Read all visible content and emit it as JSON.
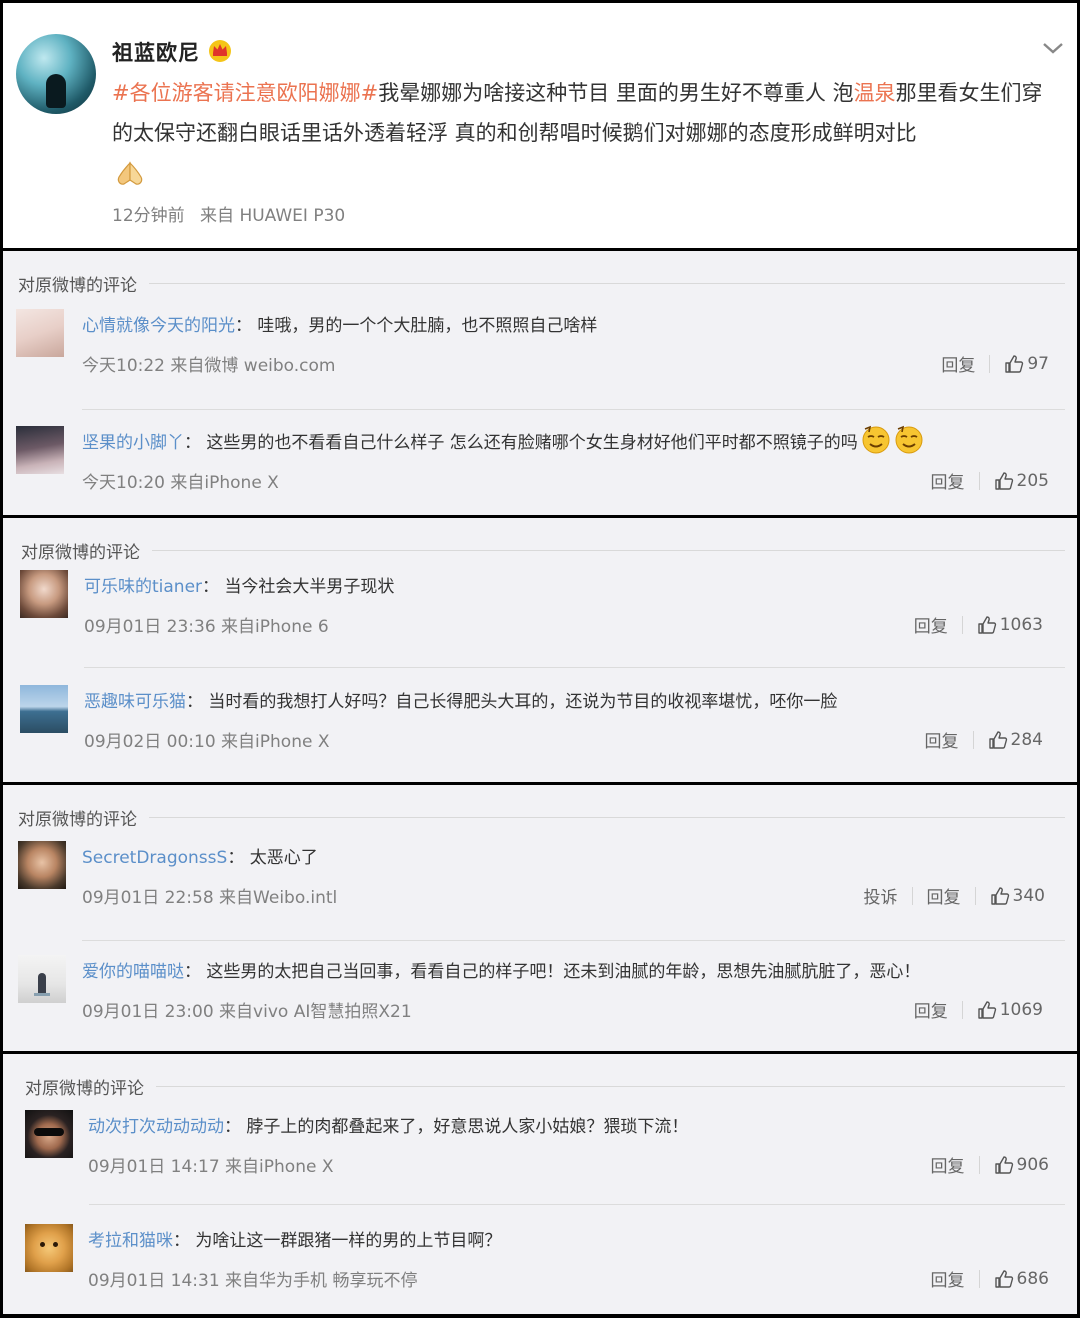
{
  "post": {
    "author": "祖蓝欧尼",
    "hashtag": "#各位游客请注意欧阳娜娜#",
    "text_a": "我晕娜娜为啥接这种节目 里面的男生好不尊重人 泡",
    "highlight": "温泉",
    "text_b": "那里看女生们穿的太保守还翻白眼话里话外透着轻浮 真的和创帮唱时候鹅们对娜娜的态度形成鲜明对比",
    "time": "12分钟前",
    "source": "来自 HUAWEI P30"
  },
  "blocks": [
    {
      "title": "对原微博的评论",
      "comments": [
        {
          "user": "心情就像今天的阳光",
          "sep": "：",
          "text": "哇哦，男的一个个大肚腩，也不照照自己啥样",
          "meta": "今天10:22 来自微博 weibo.com",
          "reply": "回复",
          "likes": "97"
        },
        {
          "user": "坚果的小脚丫",
          "sep": "：",
          "text": "这些男的也不看看自己什么样子 怎么还有脸赌哪个女生身材好他们平时都不照镜子的吗",
          "meta": "今天10:20 来自iPhone X",
          "reply": "回复",
          "likes": "205"
        }
      ]
    },
    {
      "title": "对原微博的评论",
      "comments": [
        {
          "user": "可乐味的tianer",
          "sep": "：",
          "text": "当今社会大半男子现状",
          "meta": "09月01日 23:36 来自iPhone 6",
          "reply": "回复",
          "likes": "1063"
        },
        {
          "user": "恶趣味可乐猫",
          "sep": "：",
          "text": "当时看的我想打人好吗？自己长得肥头大耳的，还说为节目的收视率堪忧，呸你一脸",
          "meta": "09月02日 00:10 来自iPhone X",
          "reply": "回复",
          "likes": "284"
        }
      ]
    },
    {
      "title": "对原微博的评论",
      "comments": [
        {
          "user": "SecretDragonssS",
          "sep": "：",
          "text": "太恶心了",
          "meta": "09月01日 22:58 来自Weibo.intl",
          "report": "投诉",
          "reply": "回复",
          "likes": "340"
        },
        {
          "user": "爱你的喵喵哒",
          "sep": "：",
          "text": "这些男的太把自己当回事，看看自己的样子吧！还未到油腻的年龄，思想先油腻肮脏了，恶心！",
          "meta": "09月01日 23:00 来自vivo AI智慧拍照X21",
          "reply": "回复",
          "likes": "1069"
        }
      ]
    },
    {
      "title": "对原微博的评论",
      "comments": [
        {
          "user": "动次打次动动动动",
          "sep": "：",
          "text": "脖子上的肉都叠起来了，好意思说人家小姑娘？猥琐下流！",
          "meta": "09月01日 14:17 来自iPhone X",
          "reply": "回复",
          "likes": "906"
        },
        {
          "user": "考拉和猫咪",
          "sep": "：",
          "text": "为啥让这一群跟猪一样的男的上节目啊？",
          "meta": "09月01日 14:31 来自华为手机 畅享玩不停",
          "reply": "回复",
          "likes": "686"
        }
      ]
    }
  ],
  "colors": {
    "link": "#5b8fc9",
    "highlight": "#eb7350",
    "meta": "#808080",
    "block_bg": "#f2f2f5"
  },
  "icons": [
    "crown-icon",
    "chevron-down-icon",
    "praying-hands-icon",
    "thumbs-up-icon",
    "smug-face-emoji"
  ]
}
